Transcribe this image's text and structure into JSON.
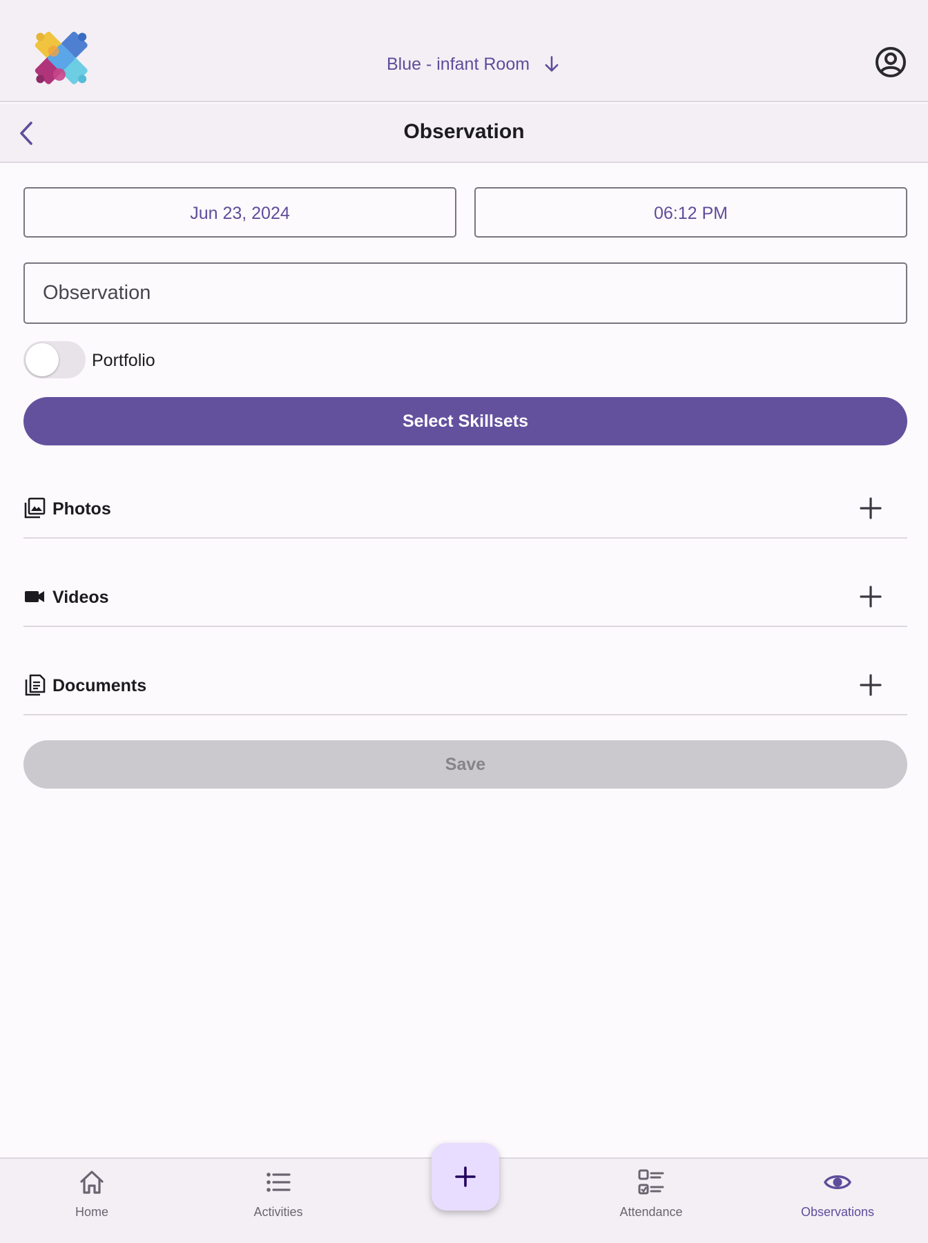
{
  "header": {
    "room_selector": "Blue - infant Room",
    "logo_icon": "puzzle-logo",
    "account_icon": "account-circle-icon"
  },
  "titlebar": {
    "back_icon": "chevron-left-icon",
    "title": "Observation"
  },
  "form": {
    "date_value": "Jun 23, 2024",
    "time_value": "06:12 PM",
    "observation_placeholder": "Observation",
    "observation_value": "",
    "portfolio_label": "Portfolio",
    "portfolio_enabled": false,
    "select_skillsets_label": "Select Skillsets",
    "save_label": "Save",
    "save_enabled": false
  },
  "attachments": [
    {
      "label": "Photos",
      "icon": "photo-library-icon"
    },
    {
      "label": "Videos",
      "icon": "videocam-icon"
    },
    {
      "label": "Documents",
      "icon": "document-icon"
    }
  ],
  "bottom_nav": {
    "items": [
      {
        "label": "Home",
        "icon": "home-icon",
        "active": false
      },
      {
        "label": "Activities",
        "icon": "list-icon",
        "active": false
      },
      {
        "label": "Attendance",
        "icon": "checklist-icon",
        "active": false
      },
      {
        "label": "Observations",
        "icon": "eye-icon",
        "active": true
      }
    ],
    "fab_icon": "plus-icon"
  },
  "colors": {
    "primary": "#63519e",
    "accent_text": "#5e4d9a",
    "surface": "#f3eff5",
    "background": "#fdfafd",
    "disabled_button": "#cbc9cd",
    "fab": "#e9ddff"
  }
}
